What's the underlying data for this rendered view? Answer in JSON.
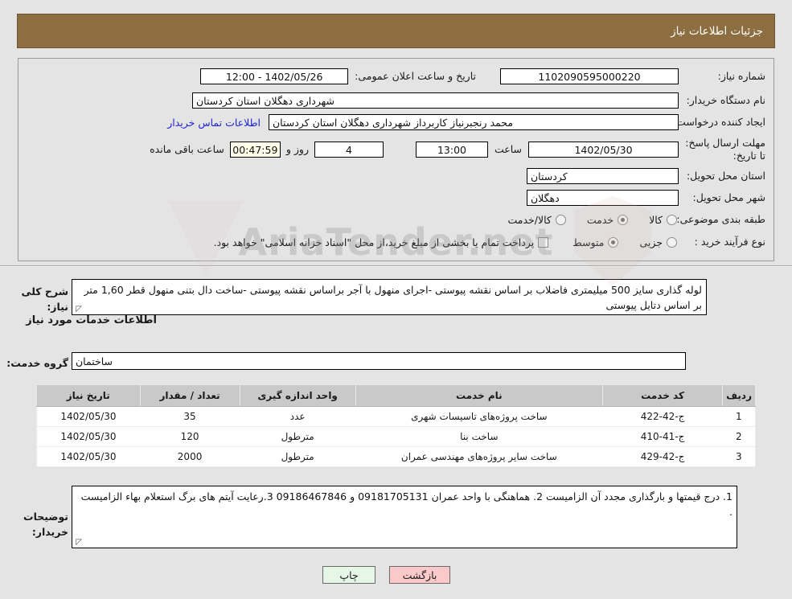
{
  "header": {
    "title": "جزئیات اطلاعات نیاز"
  },
  "watermark": {
    "text": "AriaTender.net"
  },
  "fields": {
    "need_number": {
      "label": "شماره نیاز:",
      "value": "1102090595000220"
    },
    "public_announce": {
      "label": "تاریخ و ساعت اعلان عمومی:",
      "value": "1402/05/26 - 12:00"
    },
    "buyer_org": {
      "label": "نام دستگاه خریدار:",
      "value": "شهرداری دهگلان استان کردستان"
    },
    "request_creator": {
      "label": "ایجاد کننده درخواست:",
      "value": "محمد رنجبرنیاز کاربرداز شهرداری دهگلان استان کردستان"
    },
    "buyer_contact_link": {
      "label": "اطلاعات تماس خریدار"
    },
    "deadline": {
      "label": "مهلت ارسال پاسخ: تا تاریخ:",
      "date": "1402/05/30",
      "hour_label": "ساعت",
      "hour": "13:00",
      "days": "4",
      "days_label": "روز و",
      "countdown": "00:47:59",
      "remaining_label": "ساعت باقی مانده"
    },
    "delivery_province": {
      "label": "استان محل تحویل:",
      "value": "کردستان"
    },
    "delivery_city": {
      "label": "شهر محل تحویل:",
      "value": "دهگلان"
    },
    "category": {
      "label": "طبقه بندی موضوعی:",
      "options": [
        {
          "label": "کالا",
          "selected": false
        },
        {
          "label": "خدمت",
          "selected": true
        },
        {
          "label": "کالا/خدمت",
          "selected": false
        }
      ]
    },
    "process_type": {
      "label": "نوع فرآیند خرید :",
      "options": [
        {
          "label": "جزیی",
          "selected": false
        },
        {
          "label": "متوسط",
          "selected": true
        }
      ],
      "checkbox_label": "پرداخت تمام یا بخشی از مبلغ خرید،از محل \"اسناد خزانه اسلامی\" خواهد بود.",
      "checkbox_checked": false
    },
    "need_summary": {
      "label": "شرح کلی نیاز:",
      "value": "لوله گذاری سایز 500 میلیمتری فاضلاب بر اساس نقشه پیوستی -اجرای منهول با آجر براساس نقشه پیوستی -ساخت دال بتنی منهول قطر 1,60 متر بر اساس دتایل پیوستی"
    },
    "services_section_title": "اطلاعات خدمات مورد نیاز",
    "service_group": {
      "label": "گروه خدمت:",
      "value": "ساختمان"
    },
    "buyer_notes": {
      "label": "توضیحات خریدار:",
      "value": "1. درج قیمتها و بارگذاری مجدد آن الزامیست   2. هماهنگی با واحد عمران 09181705131 و 09186467846      3.رعایت آیتم های برگ استعلام بهاء الزامیست ."
    }
  },
  "table": {
    "columns": [
      "ردیف",
      "کد خدمت",
      "نام خدمت",
      "واحد اندازه گیری",
      "تعداد / مقدار",
      "تاریخ نیاز"
    ],
    "rows": [
      {
        "radif": "1",
        "code": "ج-42-422",
        "name": "ساخت پروژه‌های تاسیسات شهری",
        "unit": "عدد",
        "qty": "35",
        "date": "1402/05/30"
      },
      {
        "radif": "2",
        "code": "ج-41-410",
        "name": "ساخت بنا",
        "unit": "مترطول",
        "qty": "120",
        "date": "1402/05/30"
      },
      {
        "radif": "3",
        "code": "ج-42-429",
        "name": "ساخت سایر پروژه‌های مهندسی عمران",
        "unit": "مترطول",
        "qty": "2000",
        "date": "1402/05/30"
      }
    ]
  },
  "buttons": {
    "print": "چاپ",
    "back": "بازگشت"
  },
  "colors": {
    "header_bg": "#8d6e41",
    "page_bg": "#e4e4e4",
    "link": "#1e22d8",
    "countdown_bg": "#fffde8",
    "print_bg": "#e7f7e7",
    "back_bg": "#fbc9ca",
    "table_header_bg": "#c9c9c9"
  }
}
